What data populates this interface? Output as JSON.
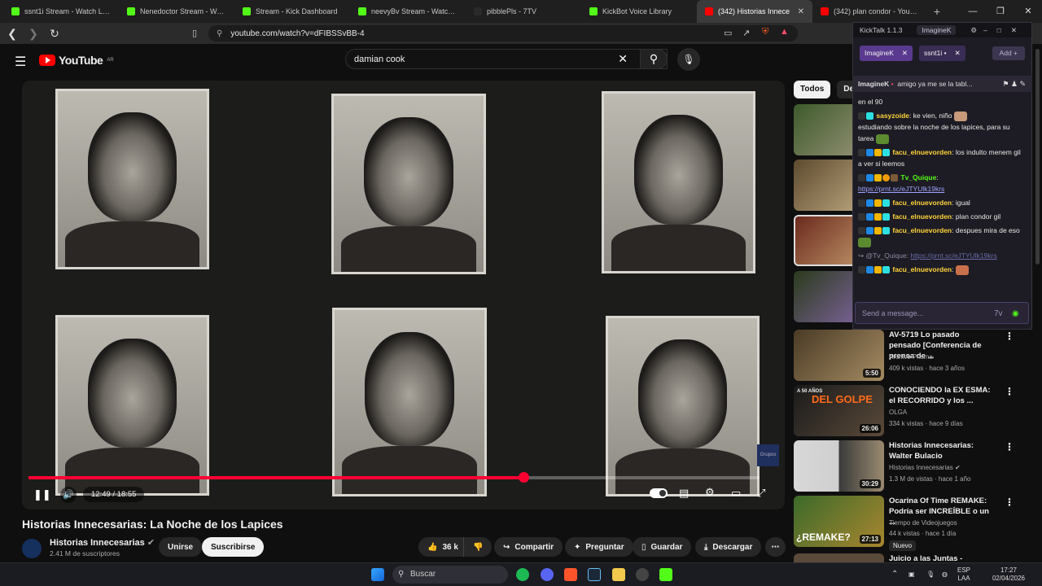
{
  "browser": {
    "tabs": [
      {
        "label": "ssnt1i Stream - Watch Live",
        "color": "#53fc18"
      },
      {
        "label": "Nenedoctor Stream - Watch",
        "color": "#53fc18"
      },
      {
        "label": "Stream - Kick Dashboard",
        "color": "#53fc18"
      },
      {
        "label": "neevyBv Stream - Watch L",
        "color": "#53fc18"
      },
      {
        "label": "pibblePls - 7TV",
        "color": "#2a2a2a"
      },
      {
        "label": "KickBot Voice Library",
        "color": "#53fc18"
      },
      {
        "label": "(342) Historias Innece",
        "color": "#ff0000",
        "active": true
      },
      {
        "label": "(342) plan condor - YouTube",
        "color": "#ff0000"
      }
    ],
    "url": "youtube.com/watch?v=dFIBSSvBB-4"
  },
  "youtube": {
    "logo_region": "AR",
    "search_query": "damian cook",
    "player": {
      "current_time": "12:49",
      "duration": "18:55",
      "time_display": "12:49 / 18:55",
      "progress": 0.677,
      "watermark": "Grupos"
    },
    "video": {
      "title": "Historias Innecesarias: La Noche de los Lapices",
      "channel": "Historias Innecesarias",
      "subscribers": "2.41 M de suscriptores",
      "join_label": "Unirse",
      "subscribe_label": "Suscribirse",
      "likes": "36 k",
      "share_label": "Compartir",
      "ask_label": "Preguntar",
      "save_label": "Guardar",
      "download_label": "Descargar"
    },
    "chips": [
      "Todos",
      "De H"
    ],
    "recommendations": [
      {
        "title": "AV-5719 Lo pasado pensado [Conferencia de prensa de ...",
        "channel": "Archivo Prisma",
        "meta": "409 k vistas · hace 3 años",
        "duration": "5:50"
      },
      {
        "title": "CONOCIENDO la EX ESMA: el RECORRIDO y los ...",
        "channel": "OLGA",
        "meta": "334 k vistas · hace 9 días",
        "duration": "26:06",
        "thumb_text_top": "A 50 AÑOS",
        "thumb_text_big": "DEL GOLPE"
      },
      {
        "title": "Historias Innecesarias: Walter Bulacio",
        "channel": "Historias Innecesarias",
        "meta": "1.3 M de vistas · hace 1 año",
        "duration": "30:29"
      },
      {
        "title": "Ocarina Of Time REMAKE: Podría ser INCREÍBLE o un ...",
        "channel": "Tiempo de Videojuegos",
        "meta": "44 k vistas · hace 1 día",
        "duration": "27:13",
        "badge": "Nuevo",
        "thumb_text_big": "¿REMAKE?"
      },
      {
        "title": "Juicio a las Juntas - Alegato del",
        "channel": "",
        "meta": "",
        "duration": ""
      }
    ]
  },
  "kicktalk": {
    "title": "KickTalk 1.1.3",
    "user": "ImagineK",
    "tabs": [
      "ImagineK",
      "ssnt1i •"
    ],
    "add_label": "Add",
    "pinned_user": "ImagineK",
    "pinned_text": "amigo ya me se la tabl...",
    "messages": [
      {
        "user": "",
        "text": "en el 90"
      },
      {
        "user": "sasyzoide",
        "user_color": "#ffd43b",
        "text": "ke vien, niño",
        "text2": "estudiando sobre la noche de los lapices, para su tarea"
      },
      {
        "user": "facu_elnuevorden",
        "user_color": "#ffd43b",
        "text": "los indulto menem gil a ver si leemos"
      },
      {
        "user": "Tv_Quique",
        "user_color": "#53fc18",
        "text": "",
        "link": "https://prnt.sc/eJTYUlk19krs"
      },
      {
        "user": "facu_elnuevorden",
        "user_color": "#ffd43b",
        "text": "igual"
      },
      {
        "user": "facu_elnuevorden",
        "user_color": "#ffd43b",
        "text": "plan condor gil"
      },
      {
        "user": "facu_elnuevorden",
        "user_color": "#ffd43b",
        "text": "despues mira de eso"
      },
      {
        "user": "",
        "reply": "@Tv_Quique:",
        "link": "https://prnt.sc/eJTYUlk19krs"
      },
      {
        "user": "facu_elnuevorden",
        "user_color": "#ffd43b",
        "text": ""
      }
    ],
    "input_placeholder": "Send a message..."
  },
  "taskbar": {
    "search_label": "Buscar",
    "lang": "ESP",
    "layout": "LAA",
    "time": "17:27",
    "date": "02/04/2026"
  }
}
